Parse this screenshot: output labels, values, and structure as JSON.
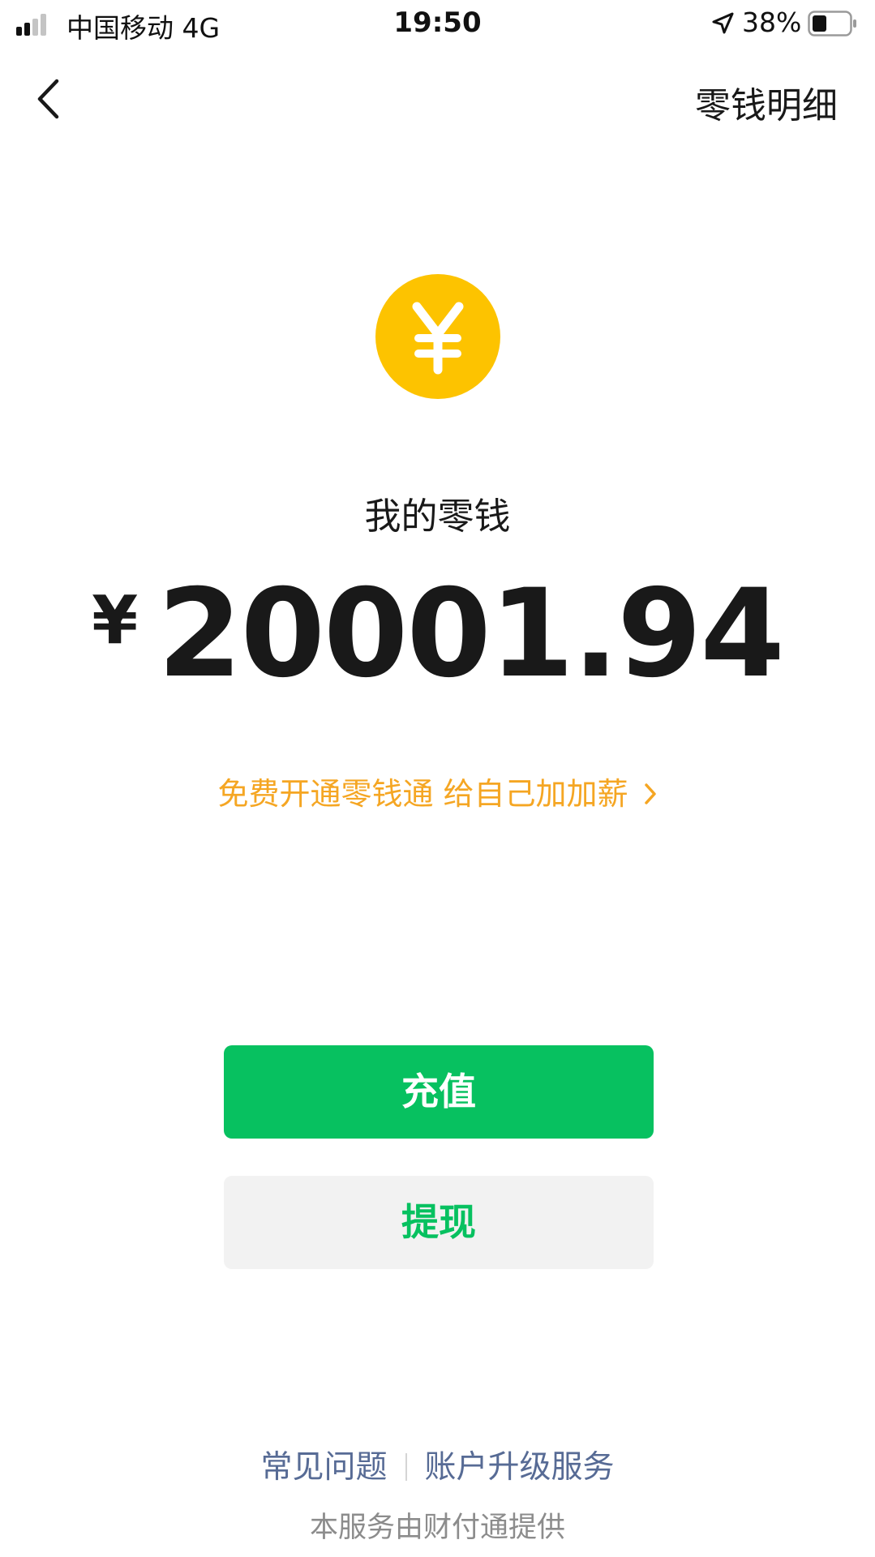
{
  "status_bar": {
    "carrier": "中国移动   4G",
    "time": "19:50",
    "battery": "38%",
    "signal_bars_filled": 2,
    "signal_bars_total": 4,
    "battery_level": 0.38,
    "icons": [
      "signal-icon",
      "location-arrow-icon",
      "battery-icon"
    ]
  },
  "nav": {
    "back_icon": "chevron-left-icon",
    "title": "零钱明细"
  },
  "balance": {
    "coin_icon": "yuan-coin-icon",
    "label": "我的零钱",
    "currency": "¥",
    "amount": "20001.94"
  },
  "promo": {
    "text": "免费开通零钱通 给自己加加薪",
    "icon": "chevron-right-icon"
  },
  "actions": {
    "recharge_label": "充值",
    "withdraw_label": "提现"
  },
  "footer": {
    "faq": "常见问题",
    "upgrade": "账户升级服务",
    "provider": "本服务由财付通提供"
  },
  "colors": {
    "primary_green": "#07c160",
    "coin_yellow": "#fdc300",
    "promo_orange": "#f5a623",
    "link_blue": "#576b95",
    "secondary_button_bg": "#f2f2f2"
  }
}
